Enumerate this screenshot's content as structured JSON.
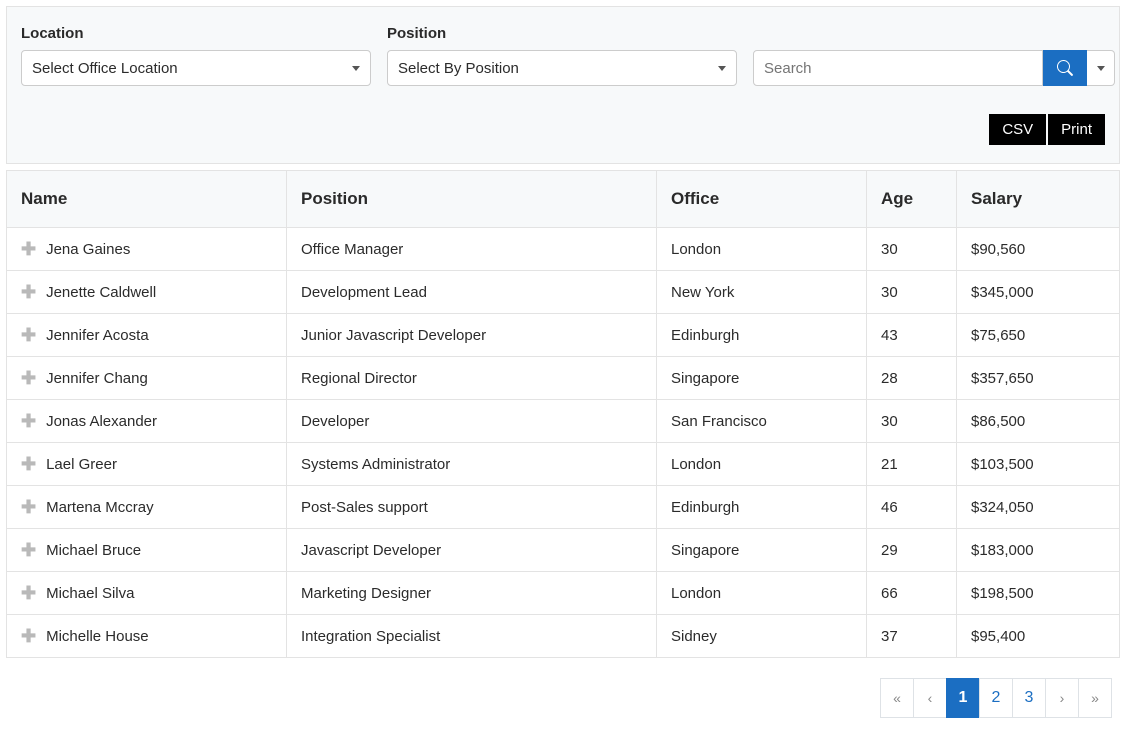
{
  "filters": {
    "location_label": "Location",
    "location_placeholder": "Select Office Location",
    "position_label": "Position",
    "position_placeholder": "Select By Position",
    "search_placeholder": "Search"
  },
  "export": {
    "csv": "CSV",
    "print": "Print"
  },
  "table": {
    "headers": {
      "name": "Name",
      "position": "Position",
      "office": "Office",
      "age": "Age",
      "salary": "Salary"
    },
    "rows": [
      {
        "name": "Jena Gaines",
        "position": "Office Manager",
        "office": "London",
        "age": "30",
        "salary": "$90,560"
      },
      {
        "name": "Jenette Caldwell",
        "position": "Development Lead",
        "office": "New York",
        "age": "30",
        "salary": "$345,000"
      },
      {
        "name": "Jennifer Acosta",
        "position": "Junior Javascript Developer",
        "office": "Edinburgh",
        "age": "43",
        "salary": "$75,650"
      },
      {
        "name": "Jennifer Chang",
        "position": "Regional Director",
        "office": "Singapore",
        "age": "28",
        "salary": "$357,650"
      },
      {
        "name": "Jonas Alexander",
        "position": "Developer",
        "office": "San Francisco",
        "age": "30",
        "salary": "$86,500"
      },
      {
        "name": "Lael Greer",
        "position": "Systems Administrator",
        "office": "London",
        "age": "21",
        "salary": "$103,500"
      },
      {
        "name": "Martena Mccray",
        "position": "Post-Sales support",
        "office": "Edinburgh",
        "age": "46",
        "salary": "$324,050"
      },
      {
        "name": "Michael Bruce",
        "position": "Javascript Developer",
        "office": "Singapore",
        "age": "29",
        "salary": "$183,000"
      },
      {
        "name": "Michael Silva",
        "position": "Marketing Designer",
        "office": "London",
        "age": "66",
        "salary": "$198,500"
      },
      {
        "name": "Michelle House",
        "position": "Integration Specialist",
        "office": "Sidney",
        "age": "37",
        "salary": "$95,400"
      }
    ]
  },
  "pagination": {
    "first": "«",
    "prev": "‹",
    "next": "›",
    "last": "»",
    "pages": [
      "1",
      "2",
      "3"
    ],
    "active": "1"
  }
}
